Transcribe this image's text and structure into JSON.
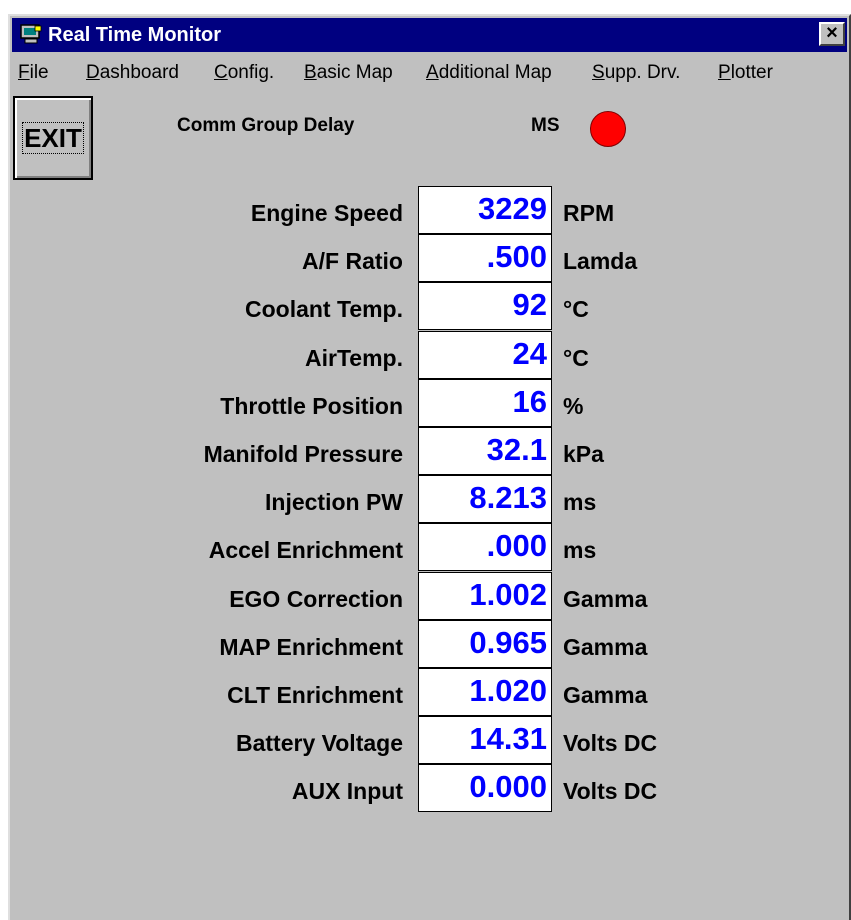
{
  "window": {
    "title": "Real Time Monitor",
    "close_label": "×"
  },
  "menu": [
    "File",
    "Dashboard",
    "Config.",
    "Basic Map",
    "Additional Map",
    "Supp. Drv.",
    "Plotter"
  ],
  "exit_label": "EXIT",
  "status": {
    "comm_label": "Comm Group Delay",
    "ms_label": "MS",
    "ms_indicator_color": "#ff0000"
  },
  "rows": [
    {
      "label": "Engine Speed",
      "value": "3229",
      "unit": "RPM"
    },
    {
      "label": "A/F Ratio",
      "value": ".500",
      "unit": "Lamda"
    },
    {
      "label": "Coolant Temp.",
      "value": "92",
      "unit": "°C"
    },
    {
      "label": "AirTemp.",
      "value": "24",
      "unit": "°C"
    },
    {
      "label": "Throttle Position",
      "value": "16",
      "unit": "%"
    },
    {
      "label": "Manifold Pressure",
      "value": "32.1",
      "unit": "kPa"
    },
    {
      "label": "Injection PW",
      "value": "8.213",
      "unit": "ms"
    },
    {
      "label": "Accel Enrichment",
      "value": ".000",
      "unit": "ms"
    },
    {
      "label": "EGO Correction",
      "value": "1.002",
      "unit": "Gamma"
    },
    {
      "label": "MAP Enrichment",
      "value": "0.965",
      "unit": "Gamma"
    },
    {
      "label": "CLT Enrichment",
      "value": "1.020",
      "unit": "Gamma"
    },
    {
      "label": "Battery Voltage",
      "value": "14.31",
      "unit": "Volts DC"
    },
    {
      "label": "AUX Input",
      "value": "0.000",
      "unit": "Volts DC"
    }
  ]
}
